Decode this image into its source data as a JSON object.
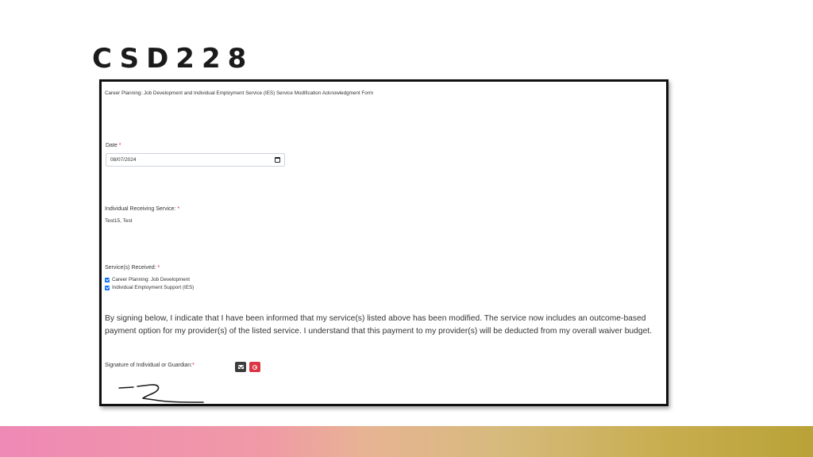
{
  "slide": {
    "title": "CSD228"
  },
  "form": {
    "header": "Career Planning: Job Development and Individual Employment Service (IES) Service Modification Acknowledgment Form",
    "date": {
      "label": "Date",
      "required_marker": "*",
      "value": "08/07/2024",
      "icon": "calendar-icon"
    },
    "individual": {
      "label": "Individual Receiving Service:",
      "required_marker": "*",
      "value": "Test15, Test"
    },
    "services": {
      "label": "Service(s) Received:",
      "required_marker": "*",
      "options": [
        {
          "label": "Career Planning: Job Development",
          "checked": true
        },
        {
          "label": "Individual Employment Support (IES)",
          "checked": true
        }
      ]
    },
    "acknowledgment": "By signing below, I indicate that I have been informed that my service(s) listed above has been modified. The service now includes an outcome-based payment option for my provider(s) of the listed service. I understand that this payment to my provider(s) will be deducted from my overall waiver budget.",
    "signature": {
      "label": "Signature of Individual or Guardian:",
      "required_marker": "*",
      "buttons": [
        {
          "icon": "envelope-icon",
          "color": "#3d3d3d"
        },
        {
          "icon": "ban-icon",
          "color": "#dc3545"
        }
      ]
    }
  },
  "colors": {
    "accent_blue": "#0d6efd",
    "required_red": "#d9232e",
    "danger_red": "#dc3545",
    "band_pink": "#ef89b5",
    "band_gold": "#b9a237"
  }
}
